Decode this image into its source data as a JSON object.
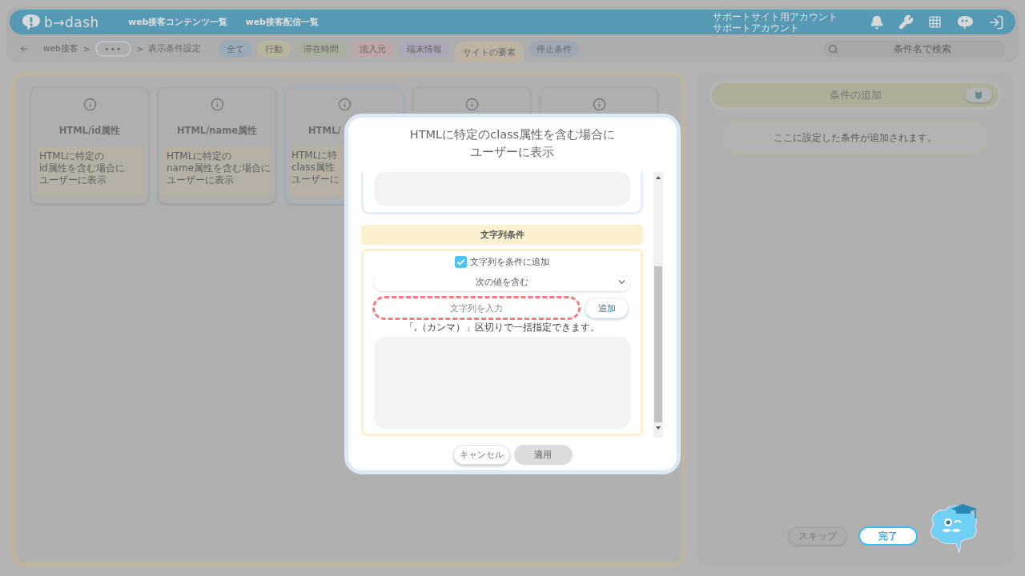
{
  "header": {
    "logo": "b→dash",
    "nav": [
      "web接客コンテンツ一覧",
      "web接客配信一覧"
    ],
    "account": [
      "サポートサイト用アカウント",
      "サポートアカウント"
    ]
  },
  "breadcrumb": [
    {
      "kind": "link",
      "label": "web接客"
    },
    {
      "kind": "separator",
      "label": ">"
    },
    {
      "kind": "more",
      "label": "•••"
    },
    {
      "kind": "separator",
      "label": ">"
    },
    {
      "kind": "current",
      "label": "表示条件設定"
    }
  ],
  "filters": [
    {
      "label": "全て",
      "color": "#9aaab8",
      "selected": false
    },
    {
      "label": "行動",
      "color": "#b9b49c",
      "selected": false
    },
    {
      "label": "滞在時間",
      "color": "#a9b0a0",
      "selected": false
    },
    {
      "label": "流入元",
      "color": "#bda6a6",
      "selected": false
    },
    {
      "label": "端末情報",
      "color": "#aea7b9",
      "selected": false
    },
    {
      "label": "サイトの要素",
      "color": "#bdb3a3",
      "selected": true
    },
    {
      "label": "停止条件",
      "color": "#a0a9b3",
      "selected": false
    }
  ],
  "search": {
    "placeholder": "条件名で検索"
  },
  "cards": [
    {
      "title": "HTML/id属性",
      "description": [
        "HTMLに特定の",
        "id属性を含む場合に",
        "ユーザーに表示"
      ],
      "selected": false
    },
    {
      "title": "HTML/name属性",
      "description": [
        "HTMLに特定の",
        "name属性を含む場合に",
        "ユーザーに表示"
      ],
      "selected": false
    },
    {
      "title": "HTML/",
      "description": [
        "HTMLに特",
        "class属性",
        "ユーザーに"
      ],
      "selected": true
    },
    {
      "selected": false
    },
    {
      "selected": false
    }
  ],
  "modal": {
    "title": [
      "HTMLに特定のclass属性を含む場合に",
      "ユーザーに表示"
    ],
    "section_title": "文字列条件",
    "checkbox": {
      "label": "文字列を条件に追加",
      "checked": true
    },
    "select": {
      "value": "次の値を含む"
    },
    "input": {
      "placeholder": "文字列を入力",
      "highlighted": true
    },
    "add_button": "追加",
    "hint": "「,（カンマ）」区切りで一括指定できます。",
    "buttons": [
      {
        "label": "キャンセル",
        "disabled": false
      },
      {
        "label": "適用",
        "disabled": true
      }
    ]
  },
  "side_panel": {
    "title": "条件の追加",
    "message": "ここに設定した条件が追加されます。",
    "buttons": [
      {
        "label": "スキップ",
        "highlighted": false
      },
      {
        "label": "完了",
        "highlighted": true
      }
    ]
  }
}
